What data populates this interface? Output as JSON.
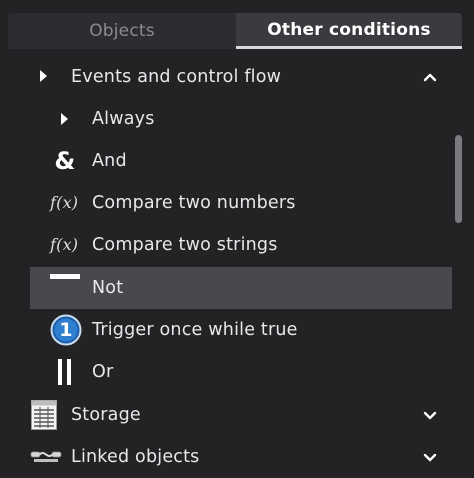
{
  "tabs": [
    {
      "label": "Objects",
      "active": false
    },
    {
      "label": "Other conditions",
      "active": true
    }
  ],
  "list": {
    "group_events": {
      "label": "Events and control flow",
      "expanded": true
    },
    "items": [
      {
        "label": "Always",
        "icon": "play-triangle-icon"
      },
      {
        "label": "And",
        "icon": "ampersand-icon"
      },
      {
        "label": "Compare two numbers",
        "icon": "function-icon"
      },
      {
        "label": "Compare two strings",
        "icon": "function-icon"
      },
      {
        "label": "Not",
        "icon": "not-bar-icon",
        "selected": true
      },
      {
        "label": "Trigger once while true",
        "icon": "number-one-icon"
      },
      {
        "label": "Or",
        "icon": "or-bars-icon"
      }
    ],
    "group_storage": {
      "label": "Storage",
      "expanded": false
    },
    "group_linked": {
      "label": "Linked objects",
      "expanded": false
    }
  },
  "icons": {
    "and_glyph": "&",
    "function_glyph": "f(x)",
    "one_glyph": "1"
  },
  "colors": {
    "background": "#232326",
    "selected_row": "#48484e",
    "trigger_blue": "#2f7fd1"
  }
}
